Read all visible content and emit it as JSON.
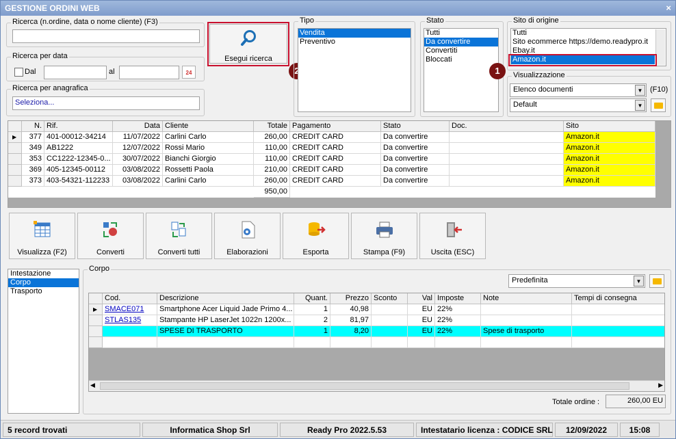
{
  "window": {
    "title": "GESTIONE ORDINI WEB",
    "close": "×"
  },
  "search": {
    "label": "Ricerca (n.ordine, data o nome cliente) (F3)",
    "value": "",
    "button": "Esegui ricerca",
    "date_group": "Ricerca per data",
    "dal_label": "Dal",
    "al_label": "al",
    "dal_value": "",
    "al_value": "",
    "calendar_label": "24",
    "anagrafica_group": "Ricerca per anagrafica",
    "anagrafica_value": "Seleziona..."
  },
  "tipo": {
    "label": "Tipo",
    "items": [
      "Vendita",
      "Preventivo"
    ],
    "selected": 0
  },
  "stato": {
    "label": "Stato",
    "items": [
      "Tutti",
      "Da convertire",
      "Convertiti",
      "Bloccati"
    ],
    "selected": 1
  },
  "sito": {
    "label": "Sito di origine",
    "items": [
      "Tutti",
      "Sito ecommerce https://demo.readypro.it",
      "Ebay.it",
      "Amazon.it"
    ],
    "selected": 3
  },
  "visualizzazione": {
    "label": "Visualizzazione",
    "combo1": "Elenco documenti",
    "shortcut": "(F10)",
    "combo2": "Default"
  },
  "markers": [
    "1",
    "2"
  ],
  "orders": {
    "columns": [
      "N.",
      "Rif.",
      "Data",
      "Cliente",
      "Totale",
      "Pagamento",
      "Stato",
      "Doc.",
      "Sito"
    ],
    "rows": [
      [
        "377",
        "401-00012-34214",
        "11/07/2022",
        "Carlini Carlo",
        "260,00",
        "CREDIT CARD",
        "Da convertire",
        "",
        "Amazon.it"
      ],
      [
        "349",
        "AB1222",
        "12/07/2022",
        "Rossi Mario",
        "110,00",
        "CREDIT CARD",
        "Da convertire",
        "",
        "Amazon.it"
      ],
      [
        "353",
        "CC1222-12345-0...",
        "30/07/2022",
        "Bianchi Giorgio",
        "110,00",
        "CREDIT CARD",
        "Da convertire",
        "",
        "Amazon.it"
      ],
      [
        "369",
        "405-12345-00112",
        "03/08/2022",
        "Rossetti Paola",
        "210,00",
        "CREDIT CARD",
        "Da convertire",
        "",
        "Amazon.it"
      ],
      [
        "373",
        "403-54321-112233",
        "03/08/2022",
        "Carlini Carlo",
        "260,00",
        "CREDIT CARD",
        "Da convertire",
        "",
        "Amazon.it"
      ]
    ],
    "total": "950,00",
    "site_highlight": "#ffff00",
    "current_row_indicator": "▶"
  },
  "toolbar": [
    "Visualizza (F2)",
    "Converti",
    "Converti tutti",
    "Elaborazioni",
    "Esporta",
    "Stampa (F9)",
    "Uscita (ESC)"
  ],
  "sections": {
    "items": [
      "Intestazione",
      "Corpo",
      "Trasporto"
    ],
    "selected": 1
  },
  "corpo": {
    "label": "Corpo",
    "combo": "Predefinita",
    "columns": [
      "Cod.",
      "Descrizione",
      "Quant.",
      "Prezzo",
      "Sconto",
      "Val",
      "Imposte",
      "Note",
      "Tempi di consegna"
    ],
    "rows": [
      [
        "SMACE071",
        "Smartphone Acer Liquid Jade Primo 4...",
        "1",
        "40,98",
        "",
        "EU",
        "22%",
        "",
        ""
      ],
      [
        "STLAS135",
        "Stampante HP LaserJet 1022n 1200x...",
        "2",
        "81,97",
        "",
        "EU",
        "22%",
        "",
        ""
      ],
      [
        "",
        "SPESE DI TRASPORTO",
        "1",
        "8,20",
        "",
        "EU",
        "22%",
        "Spese di trasporto",
        ""
      ]
    ],
    "highlight": "#00ffff",
    "total_label": "Totale ordine :",
    "total_value": "260,00 EU"
  },
  "status": {
    "records": "5 record trovati",
    "company": "Informatica Shop Srl",
    "version": "Ready Pro 2022.5.53",
    "license": "Intestatario licenza : CODICE SRL",
    "date": "12/09/2022",
    "time": "15:08"
  }
}
